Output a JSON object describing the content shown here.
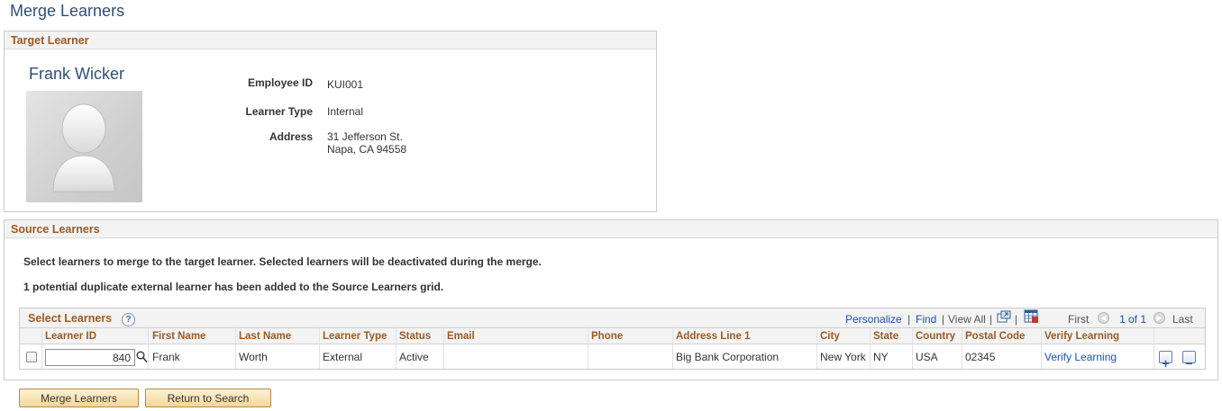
{
  "page_title": "Merge Learners",
  "target": {
    "header": "Target Learner",
    "name": "Frank Wicker",
    "photo_icon": "person-silhouette-icon",
    "fields": {
      "employee_id_label": "Employee ID",
      "employee_id": "KUI001",
      "learner_type_label": "Learner Type",
      "learner_type": "Internal",
      "address_label": "Address",
      "address_line1": "31 Jefferson St.",
      "address_line2": "Napa, CA 94558"
    }
  },
  "source": {
    "header": "Source Learners",
    "instruction": "Select learners to merge to the target learner. Selected learners will be deactivated during the merge.",
    "notice": "1 potential duplicate external learner has been added to the Source Learners grid.",
    "grid": {
      "title": "Select Learners",
      "help_symbol": "?",
      "toolbar": {
        "personalize": "Personalize",
        "sep": "|",
        "find": "Find",
        "view_all": "View All",
        "first": "First",
        "range": "1 of 1",
        "last": "Last"
      },
      "columns": {
        "learner_id": "Learner ID",
        "first_name": "First Name",
        "last_name": "Last Name",
        "learner_type": "Learner Type",
        "status": "Status",
        "email": "Email",
        "phone": "Phone",
        "address_line1": "Address Line 1",
        "city": "City",
        "state": "State",
        "country": "Country",
        "postal_code": "Postal Code",
        "verify_learning": "Verify Learning"
      },
      "rows": [
        {
          "selected": false,
          "learner_id": "840",
          "first_name": "Frank",
          "last_name": "Worth",
          "learner_type": "External",
          "status": "Active",
          "email": "",
          "phone": "",
          "address_line1": "Big Bank Corporation",
          "city": "New York",
          "state": "NY",
          "country": "USA",
          "postal_code": "02345",
          "verify_learning": "Verify Learning",
          "add_symbol": "+",
          "delete_symbol": "−"
        }
      ]
    }
  },
  "buttons": {
    "merge": "Merge Learners",
    "return": "Return to Search"
  },
  "colors": {
    "title_blue": "#2f4f76",
    "section_header_brown": "#9b5a23",
    "link_blue": "#1a55a4",
    "button_gold": "#f3d79b"
  }
}
